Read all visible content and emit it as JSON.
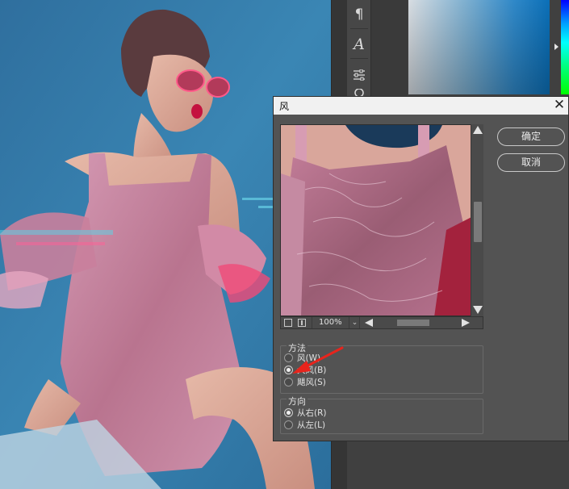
{
  "toolbar_icons": [
    "paragraph-icon",
    "character-icon",
    "adjustments-icon",
    "circle-tool-icon"
  ],
  "colors": {
    "dialog_bg": "#535353",
    "title_bar": "#f1f1f1",
    "annotation_arrow": "#e8241c"
  },
  "dialog": {
    "title": "风",
    "close_glyph": "✕",
    "ok_label": "确定",
    "cancel_label": "取消",
    "zoom": {
      "value": "100%",
      "dropdown_glyph": "⌄"
    },
    "method": {
      "label": "方法",
      "options": [
        {
          "label": "风(W)",
          "selected": false
        },
        {
          "label": "大风(B)",
          "selected": true
        },
        {
          "label": "飓风(S)",
          "selected": false
        }
      ]
    },
    "direction": {
      "label": "方向",
      "options": [
        {
          "label": "从右(R)",
          "selected": true
        },
        {
          "label": "从左(L)",
          "selected": false
        }
      ]
    }
  }
}
